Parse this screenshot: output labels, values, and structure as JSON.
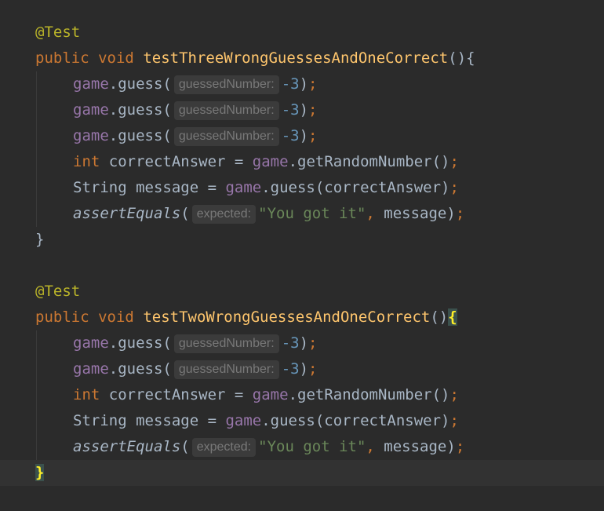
{
  "editor": {
    "methods": [
      {
        "annotation": "@Test",
        "kw_public": "public",
        "kw_void": "void",
        "name": "testThreeWrongGuessesAndOneCorrect",
        "sig_end": "(){",
        "close": "}",
        "guesses": [
          {
            "obj": "game",
            "call": ".guess(",
            "hint": "guessedNumber:",
            "arg": "-3",
            "close": ")",
            "semi": ";"
          },
          {
            "obj": "game",
            "call": ".guess(",
            "hint": "guessedNumber:",
            "arg": "-3",
            "close": ")",
            "semi": ";"
          },
          {
            "obj": "game",
            "call": ".guess(",
            "hint": "guessedNumber:",
            "arg": "-3",
            "close": ")",
            "semi": ";"
          }
        ],
        "int_line": {
          "kw": "int",
          "decl": " correctAnswer = ",
          "obj": "game",
          "call": ".getRandomNumber()",
          "semi": ";"
        },
        "msg_line": {
          "type": "String message = ",
          "obj": "game",
          "call": ".guess(correctAnswer)",
          "semi": ";"
        },
        "assert_line": {
          "fn": "assertEquals",
          "open": "(",
          "hint": "expected:",
          "str": "\"You got it\"",
          "comma": ",",
          "rest": " message)",
          "semi": ";"
        }
      },
      {
        "annotation": "@Test",
        "kw_public": "public",
        "kw_void": "void",
        "name": "testTwoWrongGuessesAndOneCorrect",
        "sig_end": "()",
        "brace": "{",
        "close": "}",
        "guesses": [
          {
            "obj": "game",
            "call": ".guess(",
            "hint": "guessedNumber:",
            "arg": "-3",
            "close": ")",
            "semi": ";"
          },
          {
            "obj": "game",
            "call": ".guess(",
            "hint": "guessedNumber:",
            "arg": "-3",
            "close": ")",
            "semi": ";"
          }
        ],
        "int_line": {
          "kw": "int",
          "decl": " correctAnswer = ",
          "obj": "game",
          "call": ".getRandomNumber()",
          "semi": ";"
        },
        "msg_line": {
          "type": "String message = ",
          "obj": "game",
          "call": ".guess(correctAnswer)",
          "semi": ";"
        },
        "assert_line": {
          "fn": "assertEquals",
          "open": "(",
          "hint": "expected:",
          "str": "\"You got it\"",
          "comma": ",",
          "rest": " message)",
          "semi": ";"
        }
      }
    ]
  }
}
